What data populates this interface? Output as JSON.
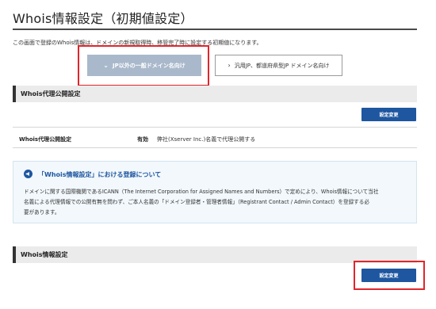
{
  "page": {
    "title": "Whois情報設定（初期値設定）",
    "intro": "この画面で登録のWhois情報は、ドメインの新規取得時、移管完了時に設定する初期値になります。"
  },
  "tabs": [
    {
      "label": "JP以外の一般ドメイン名向け",
      "active": true,
      "icon": "chevron-down-icon"
    },
    {
      "label": "汎用JP、都道府県型JP ドメイン名向け",
      "active": false,
      "icon": "chevron-right-icon"
    }
  ],
  "proxy_section": {
    "heading": "Whois代理公開設定",
    "button_label": "設定変更",
    "row": {
      "label": "Whois代理公開設定",
      "status": "有効",
      "description": "弊社(Xserver Inc.)名義で代理公開する"
    }
  },
  "notice": {
    "icon": "megaphone-icon",
    "title": "「Whois情報設定」における登録について",
    "body_lines": [
      "ドメインに関する国際機関であるICANN（The Internet Corporation for Assigned Names and Numbers）で定めにより、Whois情報について当社",
      "名義による代理情報での公開有無を問わず、ご本人名義の「ドメイン登録者・管理者情報」（Registrant Contact / Admin Contact）を登録する必",
      "要があります。"
    ]
  },
  "whois_section": {
    "heading": "Whois情報設定",
    "button_label": "設定変更"
  },
  "colors": {
    "primary": "#1e56a0",
    "active_tab": "#a9b9cb",
    "highlight": "#e0252c",
    "section_bg": "#ebebeb",
    "notice_bg": "#f2f8fc"
  }
}
